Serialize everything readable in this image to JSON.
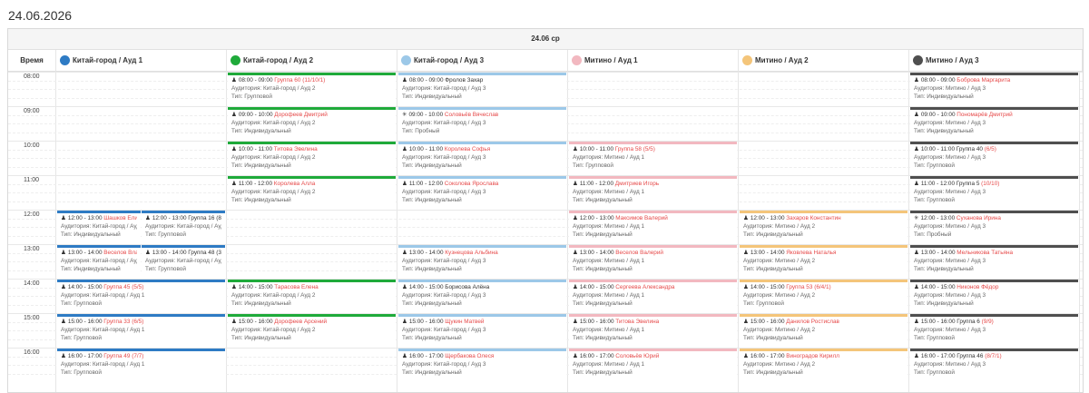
{
  "page_title": "24.06.2026",
  "day_header": "24.06 ср",
  "time_column_header": "Время",
  "times": [
    "08:00",
    "09:00",
    "10:00",
    "11:00",
    "12:00",
    "13:00",
    "14:00",
    "15:00",
    "16:00"
  ],
  "colors": {
    "blue": "#2e7bc4",
    "green": "#1faa3a",
    "lightblue": "#9cc8e8",
    "pink": "#f2b8c0",
    "yellow": "#f4c57a",
    "dark": "#4f4f4f"
  },
  "rooms": [
    {
      "label": "Китай-город / Ауд 1",
      "color": "#2e7bc4"
    },
    {
      "label": "Китай-город / Ауд 2",
      "color": "#1faa3a"
    },
    {
      "label": "Китай-город / Ауд 3",
      "color": "#9cc8e8"
    },
    {
      "label": "Митино / Ауд 1",
      "color": "#f2b8c0"
    },
    {
      "label": "Митино / Ауд 2",
      "color": "#f4c57a"
    },
    {
      "label": "Митино / Ауд 3",
      "color": "#4f4f4f"
    }
  ],
  "events": [
    {
      "room": 0,
      "sub": 0,
      "start": 12,
      "icon": "user",
      "time": "12:00 - 13:00",
      "name": "Шашков Елизавета",
      "aud": "Аудитория: Китай-город / Ауд 1",
      "type": "Тип: Индивидуальный"
    },
    {
      "room": 0,
      "sub": 1,
      "start": 12,
      "icon": "group",
      "time": "12:00 - 13:00",
      "name": "Группа 16 (8/8)",
      "black": true,
      "aud": "Аудитория: Китай-город / Ауд 1",
      "type": "Тип: Групповой"
    },
    {
      "room": 0,
      "sub": 0,
      "start": 13,
      "icon": "user",
      "time": "13:00 - 14:00",
      "name": "Веселов Владимир",
      "aud": "Аудитория: Китай-город / Ауд 1",
      "type": "Тип: Индивидуальный"
    },
    {
      "room": 0,
      "sub": 1,
      "start": 13,
      "icon": "group",
      "time": "13:00 - 14:00",
      "name": "Группа 48 (3/4)",
      "black": true,
      "aud": "Аудитория: Китай-город / Ауд 1",
      "type": "Тип: Групповой"
    },
    {
      "room": 0,
      "start": 14,
      "icon": "group",
      "time": "14:00 - 15:00",
      "name": "Группа 45",
      "count": "(5/5)",
      "aud": "Аудитория: Китай-город / Ауд 1",
      "type": "Тип: Групповой"
    },
    {
      "room": 0,
      "start": 15,
      "icon": "group",
      "time": "15:00 - 16:00",
      "name": "Группа 33",
      "count": "(6/5)",
      "aud": "Аудитория: Китай-город / Ауд 1",
      "type": "Тип: Групповой"
    },
    {
      "room": 0,
      "start": 16,
      "icon": "group",
      "time": "16:00 - 17:00",
      "name": "Группа 49",
      "count": "(7/7)",
      "aud": "Аудитория: Китай-город / Ауд 1",
      "type": "Тип: Групповой"
    },
    {
      "room": 1,
      "start": 8,
      "icon": "user",
      "time": "08:00 - 09:00",
      "name": "Группа 60",
      "count": "(11/10/1)",
      "aud": "Аудитория: Китай-город / Ауд 2",
      "type": "Тип: Групповой"
    },
    {
      "room": 1,
      "start": 9,
      "icon": "user",
      "time": "09:00 - 10:00",
      "name": "Дорофеев Дмитрий",
      "aud": "Аудитория: Китай-город / Ауд 2",
      "type": "Тип: Индивидуальный"
    },
    {
      "room": 1,
      "start": 10,
      "icon": "user",
      "time": "10:00 - 11:00",
      "name": "Титова Эвелина",
      "aud": "Аудитория: Китай-город / Ауд 2",
      "type": "Тип: Индивидуальный"
    },
    {
      "room": 1,
      "start": 11,
      "icon": "user",
      "time": "11:00 - 12:00",
      "name": "Королева Алла",
      "aud": "Аудитория: Китай-город / Ауд 2",
      "type": "Тип: Индивидуальный"
    },
    {
      "room": 1,
      "start": 14,
      "icon": "user",
      "time": "14:00 - 15:00",
      "name": "Тарасова Елена",
      "aud": "Аудитория: Китай-город / Ауд 2",
      "type": "Тип: Индивидуальный"
    },
    {
      "room": 1,
      "start": 15,
      "icon": "user",
      "time": "15:00 - 16:00",
      "name": "Дорофеев Арсений",
      "aud": "Аудитория: Китай-город / Ауд 2",
      "type": "Тип: Индивидуальный"
    },
    {
      "room": 2,
      "start": 8,
      "icon": "user",
      "time": "08:00 - 09:00",
      "name": "Фролов Захар",
      "black": true,
      "aud": "Аудитория: Китай-город / Ауд 3",
      "type": "Тип: Индивидуальный"
    },
    {
      "room": 2,
      "start": 9,
      "icon": "trial",
      "time": "09:00 - 10:00",
      "name": "Соловьёв Вячеслав",
      "aud": "Аудитория: Китай-город / Ауд 3",
      "type": "Тип: Пробный"
    },
    {
      "room": 2,
      "start": 10,
      "icon": "user",
      "time": "10:00 - 11:00",
      "name": "Королева Софья",
      "aud": "Аудитория: Китай-город / Ауд 3",
      "type": "Тип: Индивидуальный"
    },
    {
      "room": 2,
      "start": 11,
      "icon": "user",
      "time": "11:00 - 12:00",
      "name": "Соколова Ярослава",
      "aud": "Аудитория: Китай-город / Ауд 3",
      "type": "Тип: Индивидуальный"
    },
    {
      "room": 2,
      "start": 13,
      "icon": "user",
      "time": "13:00 - 14:00",
      "name": "Кузнецова Альбина",
      "aud": "Аудитория: Китай-город / Ауд 3",
      "type": "Тип: Индивидуальный"
    },
    {
      "room": 2,
      "start": 14,
      "icon": "user",
      "time": "14:00 - 15:00",
      "name": "Борисова Алёна",
      "black": true,
      "aud": "Аудитория: Китай-город / Ауд 3",
      "type": "Тип: Индивидуальный"
    },
    {
      "room": 2,
      "start": 15,
      "icon": "user",
      "time": "15:00 - 16:00",
      "name": "Щукин Матвей",
      "aud": "Аудитория: Китай-город / Ауд 3",
      "type": "Тип: Индивидуальный"
    },
    {
      "room": 2,
      "start": 16,
      "icon": "user",
      "time": "16:00 - 17:00",
      "name": "Щербакова Олеся",
      "aud": "Аудитория: Китай-город / Ауд 3",
      "type": "Тип: Индивидуальный"
    },
    {
      "room": 3,
      "start": 10,
      "icon": "group",
      "time": "10:00 - 11:00",
      "name": "Группа 58",
      "count": "(5/5)",
      "aud": "Аудитория: Митино / Ауд 1",
      "type": "Тип: Групповой"
    },
    {
      "room": 3,
      "start": 11,
      "icon": "user",
      "time": "11:00 - 12:00",
      "name": "Дмитриев Игорь",
      "aud": "Аудитория: Митино / Ауд 1",
      "type": "Тип: Индивидуальный"
    },
    {
      "room": 3,
      "start": 12,
      "icon": "user",
      "time": "12:00 - 13:00",
      "name": "Максимов Валерий",
      "aud": "Аудитория: Митино / Ауд 1",
      "type": "Тип: Индивидуальный"
    },
    {
      "room": 3,
      "start": 13,
      "icon": "user",
      "time": "13:00 - 14:00",
      "name": "Веселов Валерий",
      "aud": "Аудитория: Митино / Ауд 1",
      "type": "Тип: Индивидуальный"
    },
    {
      "room": 3,
      "start": 14,
      "icon": "user",
      "time": "14:00 - 15:00",
      "name": "Сергеева Александра",
      "aud": "Аудитория: Митино / Ауд 1",
      "type": "Тип: Индивидуальный"
    },
    {
      "room": 3,
      "start": 15,
      "icon": "user",
      "time": "15:00 - 16:00",
      "name": "Титова Эвелина",
      "aud": "Аудитория: Митино / Ауд 1",
      "type": "Тип: Индивидуальный"
    },
    {
      "room": 3,
      "start": 16,
      "icon": "user",
      "time": "16:00 - 17:00",
      "name": "Соловьёв Юрий",
      "aud": "Аудитория: Митино / Ауд 1",
      "type": "Тип: Индивидуальный"
    },
    {
      "room": 4,
      "start": 12,
      "icon": "user",
      "time": "12:00 - 13:00",
      "name": "Захаров Константин",
      "aud": "Аудитория: Митино / Ауд 2",
      "type": "Тип: Индивидуальный"
    },
    {
      "room": 4,
      "start": 13,
      "icon": "user",
      "time": "13:00 - 14:00",
      "name": "Яковлева Наталья",
      "aud": "Аудитория: Митино / Ауд 2",
      "type": "Тип: Индивидуальный"
    },
    {
      "room": 4,
      "start": 14,
      "icon": "group",
      "time": "14:00 - 15:00",
      "name": "Группа 53",
      "count": "(6/4/1)",
      "aud": "Аудитория: Митино / Ауд 2",
      "type": "Тип: Групповой"
    },
    {
      "room": 4,
      "start": 15,
      "icon": "user",
      "time": "15:00 - 16:00",
      "name": "Данилов Ростислав",
      "aud": "Аудитория: Митино / Ауд 2",
      "type": "Тип: Индивидуальный"
    },
    {
      "room": 4,
      "start": 16,
      "icon": "user",
      "time": "16:00 - 17:00",
      "name": "Виноградов Кирилл",
      "aud": "Аудитория: Митино / Ауд 2",
      "type": "Тип: Индивидуальный"
    },
    {
      "room": 5,
      "start": 8,
      "icon": "user",
      "time": "08:00 - 09:00",
      "name": "Боброва Маргарита",
      "aud": "Аудитория: Митино / Ауд 3",
      "type": "Тип: Индивидуальный"
    },
    {
      "room": 5,
      "start": 9,
      "icon": "user",
      "time": "09:00 - 10:00",
      "name": "Пономарёв Дмитрий",
      "aud": "Аудитория: Митино / Ауд 3",
      "type": "Тип: Индивидуальный"
    },
    {
      "room": 5,
      "start": 10,
      "icon": "user",
      "time": "10:00 - 11:00",
      "name": "Группа 40",
      "count": "(6/5)",
      "black": true,
      "aud": "Аудитория: Митино / Ауд 3",
      "type": "Тип: Групповой"
    },
    {
      "room": 5,
      "start": 11,
      "icon": "user",
      "time": "11:00 - 12:00",
      "name": "Группа 5",
      "count": "(10/10)",
      "black": true,
      "aud": "Аудитория: Митино / Ауд 3",
      "type": "Тип: Групповой"
    },
    {
      "room": 5,
      "start": 12,
      "icon": "trial",
      "time": "12:00 - 13:00",
      "name": "Суханова Ирина",
      "aud": "Аудитория: Митино / Ауд 3",
      "type": "Тип: Пробный"
    },
    {
      "room": 5,
      "start": 13,
      "icon": "user",
      "time": "13:00 - 14:00",
      "name": "Мельникова Татьяна",
      "aud": "Аудитория: Митино / Ауд 3",
      "type": "Тип: Индивидуальный"
    },
    {
      "room": 5,
      "start": 14,
      "icon": "user",
      "time": "14:00 - 15:00",
      "name": "Никонов Фёдор",
      "aud": "Аудитория: Митино / Ауд 3",
      "type": "Тип: Индивидуальный"
    },
    {
      "room": 5,
      "start": 15,
      "icon": "user",
      "time": "15:00 - 16:00",
      "name": "Группа 6",
      "count": "(9/9)",
      "black": true,
      "aud": "Аудитория: Митино / Ауд 3",
      "type": "Тип: Групповой"
    },
    {
      "room": 5,
      "start": 16,
      "icon": "user",
      "time": "16:00 - 17:00",
      "name": "Группа 46",
      "count": "(8/7/1)",
      "black": true,
      "aud": "Аудитория: Митино / Ауд 3",
      "type": "Тип: Групповой"
    }
  ]
}
